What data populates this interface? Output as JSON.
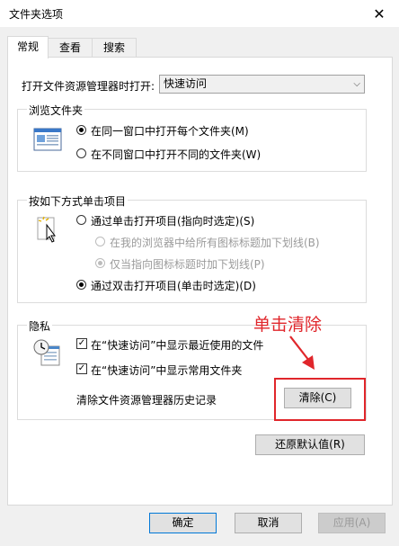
{
  "window": {
    "title": "文件夹选项",
    "close_glyph": "✕"
  },
  "tabs": [
    {
      "label": "常规",
      "active": true
    },
    {
      "label": "查看"
    },
    {
      "label": "搜索"
    }
  ],
  "open_explorer": {
    "label": "打开文件资源管理器时打开:",
    "value": "快速访问"
  },
  "browse_folders": {
    "title": "浏览文件夹",
    "options": [
      {
        "label": "在同一窗口中打开每个文件夹(M)",
        "checked": true
      },
      {
        "label": "在不同窗口中打开不同的文件夹(W)",
        "checked": false
      }
    ]
  },
  "click_items": {
    "title": "按如下方式单击项目",
    "options": [
      {
        "label": "通过单击打开项目(指向时选定)(S)",
        "checked": false
      },
      {
        "label": "在我的浏览器中给所有图标标题加下划线(B)",
        "checked": false,
        "disabled": true
      },
      {
        "label": "仅当指向图标标题时加下划线(P)",
        "checked": true,
        "disabled": true
      },
      {
        "label": "通过双击打开项目(单击时选定)(D)",
        "checked": true
      }
    ]
  },
  "privacy": {
    "title": "隐私",
    "checks": [
      {
        "label": "在“快速访问”中显示最近使用的文件",
        "checked": true
      },
      {
        "label": "在“快速访问”中显示常用文件夹",
        "checked": true
      }
    ],
    "clear_label": "清除文件资源管理器历史记录",
    "clear_button": "清除(C)"
  },
  "annotation": {
    "text": "单击清除",
    "color": "#e0262b"
  },
  "restore_button": "还原默认值(R)",
  "footer": {
    "ok": "确定",
    "cancel": "取消",
    "apply": "应用(A)"
  }
}
